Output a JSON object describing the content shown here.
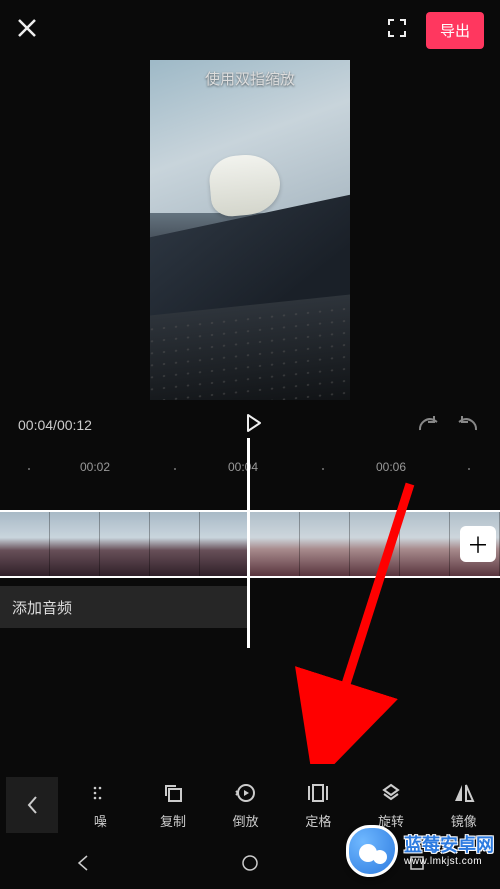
{
  "header": {
    "export_label": "导出",
    "hint": "使用双指缩放"
  },
  "playback": {
    "current": "00:04",
    "total": "00:12"
  },
  "ruler": {
    "marks": [
      "00:02",
      "00:04",
      "00:06"
    ]
  },
  "audio": {
    "add_label": "添加音频"
  },
  "toolbar": {
    "items": [
      {
        "id": "noise",
        "label": "噪"
      },
      {
        "id": "copy",
        "label": "复制"
      },
      {
        "id": "reverse",
        "label": "倒放"
      },
      {
        "id": "freeze",
        "label": "定格"
      },
      {
        "id": "rotate",
        "label": "旋转"
      },
      {
        "id": "mirror",
        "label": "镜像"
      }
    ]
  },
  "watermark": {
    "line1": "蓝莓安卓网",
    "line2": "www.lmkjst.com"
  }
}
